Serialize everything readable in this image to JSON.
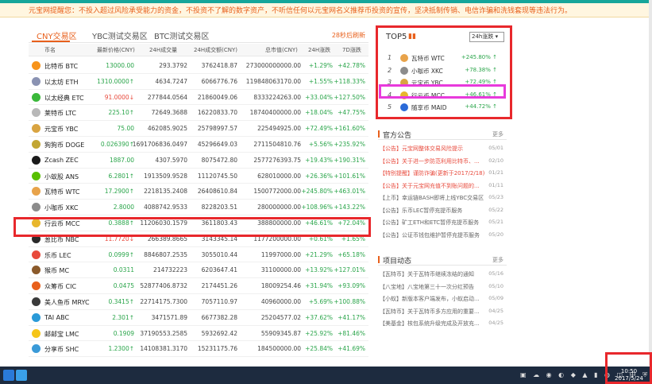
{
  "notice": "元宝网提醒您：不投入超过风险承受能力的资金，不投资不了解的数字资产，不听信任何以元宝网名义推荐币投资的宣传，坚决抵制传销、电信诈骗和洗钱套现等违法行为。",
  "tabs": [
    "CNY交易区",
    "YBC测试交易区",
    "BTC测试交易区"
  ],
  "refresh": "28秒后刷新",
  "headers": [
    "币名",
    "最新价格(CNY)",
    "24H成交量",
    "24H成交额(CNY)",
    "总市值(CNY)",
    "24H涨跌",
    "7D涨跌"
  ],
  "coins": [
    {
      "name": "比特币 BTC",
      "price": "13000.00",
      "vol": "293.3792",
      "amt": "3762418.87",
      "cap": "273000000000.00",
      "d24": "+1.29%",
      "d7": "+42.78%",
      "color": "#f7931a",
      "dir": "up"
    },
    {
      "name": "以太坊 ETH",
      "price": "1310.0000↑",
      "vol": "4634.7247",
      "amt": "6066776.76",
      "cap": "119848063170.00",
      "d24": "+1.55%",
      "d7": "+118.33%",
      "color": "#8a92b2",
      "dir": "up"
    },
    {
      "name": "以太经典 ETC",
      "price": "91.0000↓",
      "vol": "277844.0564",
      "amt": "21860049.06",
      "cap": "8333224263.00",
      "d24": "+33.04%",
      "d7": "+127.50%",
      "color": "#3ab83a",
      "dir": "down"
    },
    {
      "name": "莱特币 LTC",
      "price": "225.10↑",
      "vol": "72649.3688",
      "amt": "16220833.70",
      "cap": "18740400000.00",
      "d24": "+18.04%",
      "d7": "+47.75%",
      "color": "#b8b8b8",
      "dir": "up"
    },
    {
      "name": "元宝币 YBC",
      "price": "75.00",
      "vol": "462085.9025",
      "amt": "25798997.57",
      "cap": "225494925.00",
      "d24": "+72.49%",
      "d7": "+161.60%",
      "color": "#d9a441",
      "dir": "up"
    },
    {
      "name": "狗狗币 DOGE",
      "price": "0.026390↑",
      "vol": "1691706836.0497",
      "amt": "45296649.03",
      "cap": "2711504810.76",
      "d24": "+5.56%",
      "d7": "+235.92%",
      "color": "#c2a633",
      "dir": "up"
    },
    {
      "name": "Zcash ZEC",
      "price": "1887.00",
      "vol": "4307.5970",
      "amt": "8075472.80",
      "cap": "2577276393.75",
      "d24": "+19.43%",
      "d7": "+190.31%",
      "color": "#1a1a1a",
      "dir": "up"
    },
    {
      "name": "小蚁股 ANS",
      "price": "6.2801↑",
      "vol": "1913509.9528",
      "amt": "11120745.50",
      "cap": "628010000.00",
      "d24": "+26.36%",
      "d7": "+101.61%",
      "color": "#58bf00",
      "dir": "up"
    },
    {
      "name": "瓦特币 WTC",
      "price": "17.2900↑",
      "vol": "2218135.2408",
      "amt": "26408610.84",
      "cap": "1500772000.00",
      "d24": "+245.80%",
      "d7": "+463.01%",
      "color": "#e8a34a",
      "dir": "up"
    },
    {
      "name": "小咖币 XKC",
      "price": "2.8000",
      "vol": "4088742.9533",
      "amt": "8228203.51",
      "cap": "280000000.00",
      "d24": "+108.96%",
      "d7": "+143.22%",
      "color": "#8c8c8c",
      "dir": "up"
    },
    {
      "name": "行云币 MCC",
      "price": "0.3888↑",
      "vol": "11206030.1579",
      "amt": "3611803.43",
      "cap": "388800000.00",
      "d24": "+46.61%",
      "d7": "+72.04%",
      "color": "#e8b62c",
      "dir": "up"
    },
    {
      "name": "葱比币 NBC",
      "price": "11.7720↓",
      "vol": "266389.8665",
      "amt": "3143345.14",
      "cap": "1177200000.00",
      "d24": "+0.61%",
      "d7": "+1.65%",
      "color": "#2a2a2a",
      "dir": "down"
    },
    {
      "name": "乐币 LEC",
      "price": "0.0999↑",
      "vol": "8846807.2535",
      "amt": "3055010.44",
      "cap": "11997000.00",
      "d24": "+21.29%",
      "d7": "+65.18%",
      "color": "#e84a3c",
      "dir": "up"
    },
    {
      "name": "猴币 MC",
      "price": "0.0311",
      "vol": "214732223",
      "amt": "6203647.41",
      "cap": "31100000.00",
      "d24": "+13.92%",
      "d7": "+127.01%",
      "color": "#8b5a2b",
      "dir": "up"
    },
    {
      "name": "众筹币 CIC",
      "price": "0.0475",
      "vol": "52877406.8732",
      "amt": "2174451.26",
      "cap": "18009254.46",
      "d24": "+31.94%",
      "d7": "+93.09%",
      "color": "#e8601c",
      "dir": "up"
    },
    {
      "name": "美人鱼币 MRYC",
      "price": "0.3415↑",
      "vol": "22714175.7300",
      "amt": "7057110.97",
      "cap": "40960000.00",
      "d24": "+5.69%",
      "d7": "+100.88%",
      "color": "#3a3a3a",
      "dir": "up"
    },
    {
      "name": "TAI ABC",
      "price": "2.301↑",
      "vol": "3471571.89",
      "amt": "6677382.28",
      "cap": "25204577.02",
      "d24": "+37.62%",
      "d7": "+41.17%",
      "color": "#2a9ad8",
      "dir": "up"
    },
    {
      "name": "邮邮宝 LMC",
      "price": "0.1909",
      "vol": "37190553.2585",
      "amt": "5932692.42",
      "cap": "55909345.87",
      "d24": "+25.92%",
      "d7": "+81.46%",
      "color": "#f5c518",
      "dir": "up"
    },
    {
      "name": "分享币 SHC",
      "price": "1.2300↑",
      "vol": "14108381.3170",
      "amt": "15231175.76",
      "cap": "184500000.00",
      "d24": "+25.84%",
      "d7": "+41.69%",
      "color": "#3a9ad8",
      "dir": "up"
    }
  ],
  "top5": {
    "title": "TOP5",
    "select": "24h涨跌",
    "items": [
      {
        "rank": "1",
        "name": "瓦特币 WTC",
        "change": "+245.80% ↑",
        "color": "#e8a34a"
      },
      {
        "rank": "2",
        "name": "小咖币 XKC",
        "change": "+78.38% ↑",
        "color": "#8c8c8c"
      },
      {
        "rank": "3",
        "name": "元宝币 YBC",
        "change": "+72.49% ↑",
        "color": "#d9a441"
      },
      {
        "rank": "4",
        "name": "行云币 MCC",
        "change": "+46.61% ↑",
        "color": "#e8b62c"
      },
      {
        "rank": "5",
        "name": "随享币 MAID",
        "change": "+44.72% ↑",
        "color": "#2a6ad8"
      }
    ]
  },
  "announce": {
    "title": "官方公告",
    "more": "更多",
    "items": [
      {
        "t": "【公告】元宝网整体交易风险提示",
        "d": "05/01",
        "red": true
      },
      {
        "t": "【公告】关于进一步防范利用比特币、...",
        "d": "02/10",
        "red": true
      },
      {
        "t": "【特别提醒】谨防诈骗(更新于2017/2/18)",
        "d": "01/21",
        "red": true
      },
      {
        "t": "【公告】关于元宝网充值不到账问题的...",
        "d": "01/11",
        "red": true
      },
      {
        "t": "【上币】幸运链BASH即将上线YBC交易区",
        "d": "05/23",
        "red": false
      },
      {
        "t": "【公告】乐币LEC暂停充提币服务",
        "d": "05/22",
        "red": false
      },
      {
        "t": "【公告】矿工ETH和ETC暂停充提币服务",
        "d": "05/21",
        "red": false
      },
      {
        "t": "【公告】公证币钱包维护暂停充提币服务",
        "d": "05/20",
        "red": false
      }
    ]
  },
  "project": {
    "title": "项目动态",
    "more": "更多",
    "items": [
      {
        "t": "【瓦特币】关于瓦特币继续冻结的通知",
        "d": "05/16"
      },
      {
        "t": "【八宝地】八宝地第三十一次分红预告",
        "d": "05/10"
      },
      {
        "t": "【小蚁】新版本客户端发布，小蚁启动...",
        "d": "05/09"
      },
      {
        "t": "【瓦特币】关于瓦特币多方应用的重要...",
        "d": "04/25"
      },
      {
        "t": "【美基金】核包系统升级完成及开放充...",
        "d": "04/25"
      }
    ]
  },
  "taskbar": {
    "tray": "▣ ☁ ◉ ◐ ◆ ▲ ▮ ◍ ◫ 中 ⛨",
    "time": "10:50",
    "date": "2017/5/24"
  }
}
